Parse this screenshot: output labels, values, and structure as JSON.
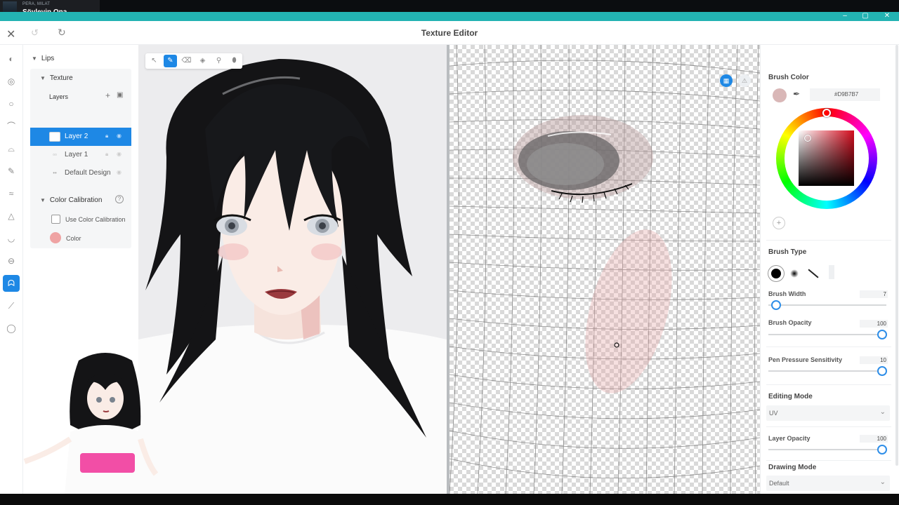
{
  "stream": {
    "now_playing_artist": "PERA, MILAT",
    "now_playing_title": "Söyleyin Ona"
  },
  "window": {
    "minimize": "‒",
    "maximize": "▢",
    "close": "✕"
  },
  "toolbar": {
    "title": "Texture Editor",
    "close_icon": "close-icon",
    "undo_icon": "undo-icon",
    "redo_icon": "redo-icon"
  },
  "left_panel": {
    "root_label": "Lips",
    "texture_label": "Texture",
    "layers_label": "Layers",
    "layers": [
      {
        "name": "Layer 2",
        "selected": true
      },
      {
        "name": "Layer 1",
        "selected": false
      },
      {
        "name": "Default Design",
        "selected": false
      }
    ],
    "calibration_label": "Color Calibration",
    "use_calibration_label": "Use Color Calibration",
    "color_label": "Color",
    "color_swatch": "#EFA3A3"
  },
  "right_panel": {
    "brush_color_label": "Brush Color",
    "brush_color_hex": "#D9B7B7",
    "brush_type_label": "Brush Type",
    "brush_width_label": "Brush Width",
    "brush_width_value": "7",
    "brush_opacity_label": "Brush Opacity",
    "brush_opacity_value": "100",
    "pen_pressure_label": "Pen Pressure Sensitivity",
    "pen_pressure_value": "10",
    "editing_mode_label": "Editing Mode",
    "editing_mode_value": "UV",
    "layer_opacity_label": "Layer Opacity",
    "layer_opacity_value": "100",
    "drawing_mode_label": "Drawing Mode",
    "drawing_mode_value": "Default"
  },
  "colors": {
    "accent": "#1E88E5",
    "window_strip": "#23B3B3"
  }
}
